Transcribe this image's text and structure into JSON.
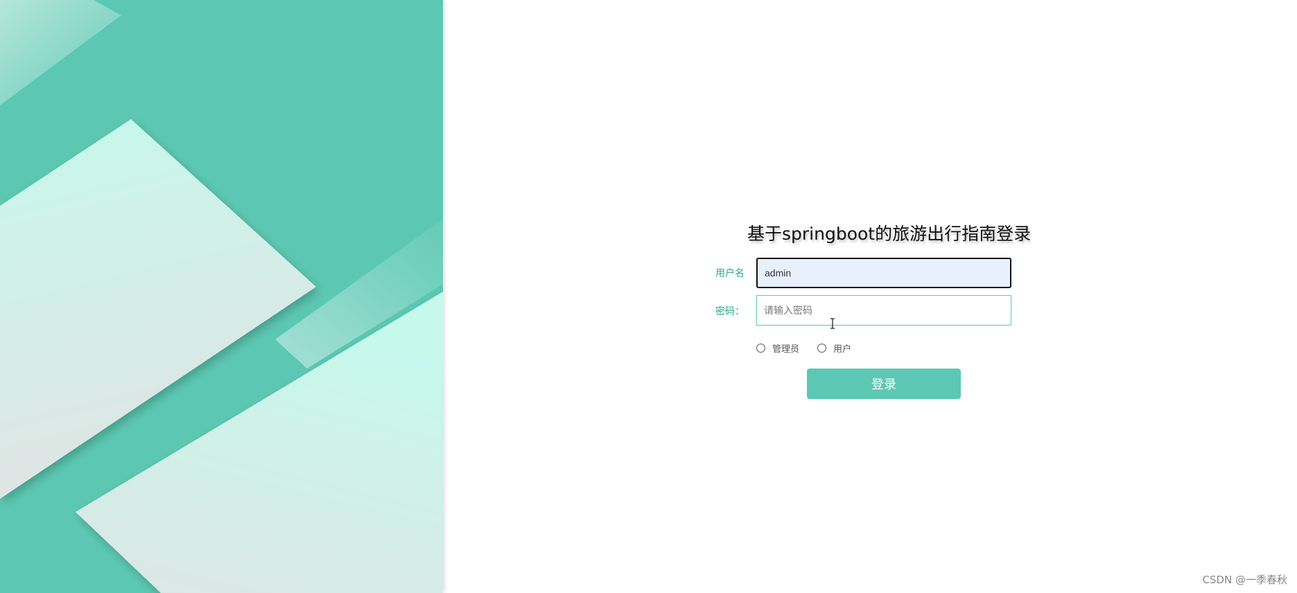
{
  "background": {
    "panel_color": "#5cc8b3",
    "shape_light_color": "#c8f7ec",
    "shape_grey_color": "#dfe4e3"
  },
  "login": {
    "title": "基于springboot的旅游出行指南登录",
    "username_label": "用户名",
    "username_value": "admin",
    "password_label": "密码：",
    "password_placeholder": "请输入密码",
    "roles": [
      {
        "label": "管理员",
        "selected": false
      },
      {
        "label": "用户",
        "selected": false
      }
    ],
    "submit_label": "登录",
    "accent_color": "#5cc8b3",
    "label_color": "#2aa88f"
  },
  "watermark": "CSDN @一季春秋"
}
